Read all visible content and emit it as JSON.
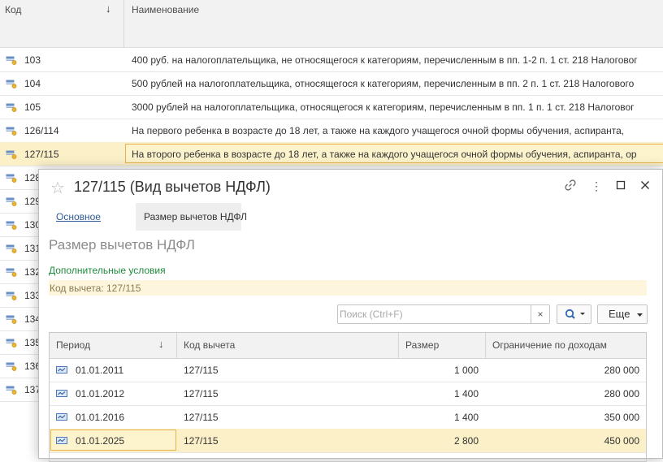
{
  "list": {
    "columns": {
      "code": "Код",
      "name": "Наименование"
    },
    "rows": [
      {
        "code": "103",
        "name": "400 руб. на налогоплательщика, не относящегося к категориям, перечисленным в пп. 1-2 п. 1 ст. 218 Налоговог"
      },
      {
        "code": "104",
        "name": "500 рублей на налогоплательщика, относящегося к категориям, перечисленным в пп. 2 п. 1 ст. 218 Налогового"
      },
      {
        "code": "105",
        "name": "3000 рублей на налогоплательщика, относящегося к категориям, перечисленным в пп. 1 п. 1 ст. 218 Налоговог"
      },
      {
        "code": "126/114",
        "name": "На первого ребенка в возрасте до 18 лет, а также на каждого учащегося очной формы обучения, аспиранта,"
      },
      {
        "code": "127/115",
        "name": "На второго ребенка в возрасте до 18 лет, а также на каждого учащегося очной формы обучения, аспиранта, ор"
      },
      {
        "code": "128",
        "name": ""
      },
      {
        "code": "129",
        "name": ""
      },
      {
        "code": "130",
        "name": ""
      },
      {
        "code": "131",
        "name": ""
      },
      {
        "code": "132",
        "name": ""
      },
      {
        "code": "133",
        "name": ""
      },
      {
        "code": "134",
        "name": ""
      },
      {
        "code": "135",
        "name": ""
      },
      {
        "code": "136",
        "name": ""
      },
      {
        "code": "137",
        "name": ""
      }
    ]
  },
  "dialog": {
    "title": "127/115 (Вид вычетов НДФЛ)",
    "tabs": {
      "main": "Основное",
      "active": "Размер вычетов НДФЛ"
    },
    "section_title": "Размер вычетов НДФЛ",
    "extra_conditions": "Дополнительные условия",
    "code_line": "Код вычета: 127/115",
    "search": {
      "placeholder": "Поиск (Ctrl+F)",
      "clear": "×"
    },
    "more_button": "Еще",
    "table": {
      "columns": {
        "period": "Период",
        "code": "Код вычета",
        "size": "Размер",
        "limit": "Ограничение по доходам"
      },
      "rows": [
        {
          "period": "01.01.2011",
          "code": "127/115",
          "size": "1 000",
          "limit": "280 000"
        },
        {
          "period": "01.01.2012",
          "code": "127/115",
          "size": "1 400",
          "limit": "280 000"
        },
        {
          "period": "01.01.2016",
          "code": "127/115",
          "size": "1 400",
          "limit": "350 000"
        },
        {
          "period": "01.01.2025",
          "code": "127/115",
          "size": "2 800",
          "limit": "450 000"
        }
      ]
    }
  },
  "colors": {
    "selection": "#fbf0c8",
    "selection_border": "#e6b34e",
    "link": "#2f5c97",
    "green_label": "#1f8a3c"
  }
}
